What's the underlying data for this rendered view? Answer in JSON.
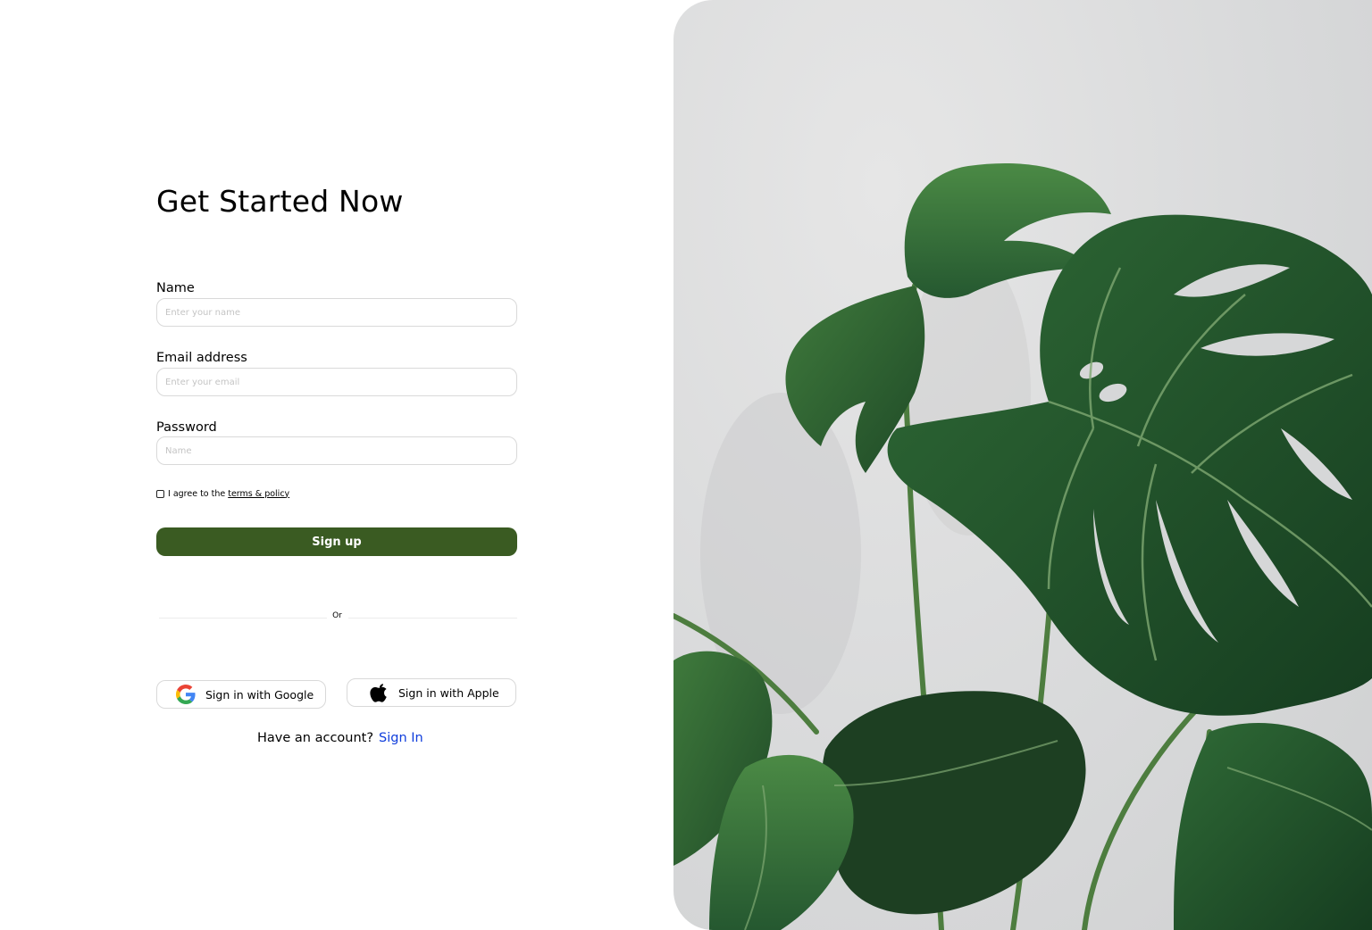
{
  "form": {
    "title": "Get Started Now",
    "name_label": "Name",
    "name_placeholder": "Enter your name",
    "email_label": "Email address",
    "email_placeholder": "Enter your email",
    "password_label": "Password",
    "password_placeholder": "Name",
    "agree_text": "I agree to the",
    "agree_link": "terms & policy",
    "signup_label": "Sign up",
    "divider_text": "Or",
    "google_label": "Sign in with Google",
    "apple_label": "Sign in with Apple",
    "have_account_text": "Have an account?",
    "signin_link": "Sign In"
  },
  "hero": {
    "icon": "monstera-plant-photo"
  },
  "colors": {
    "primary_button": "#3a5b22",
    "link": "#0f3ddc",
    "input_border": "#d9d9d9",
    "photo_background": "#d9dadb",
    "leaf": "#2b5a30"
  }
}
